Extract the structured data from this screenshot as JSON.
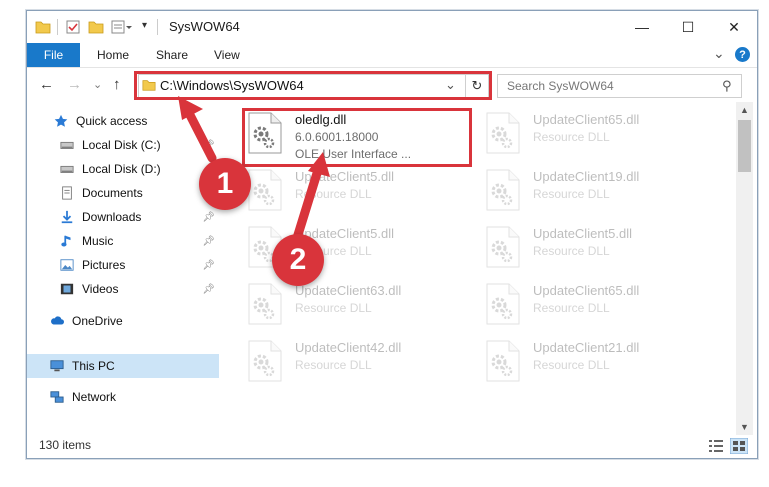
{
  "window": {
    "title": "SysWOW64",
    "minimize": "—",
    "maximize": "☐",
    "close": "✕"
  },
  "ribbon": {
    "tabs": [
      "File",
      "Home",
      "Share",
      "View"
    ],
    "expand": "⌄",
    "help": "?"
  },
  "address": {
    "path": "C:\\Windows\\SysWOW64",
    "dropdown": "⌄",
    "refresh": "↻",
    "search_placeholder": "Search SysWOW64",
    "search_icon": "⚲"
  },
  "nav": {
    "back": "←",
    "forward": "→",
    "recent": "⌄",
    "up": "↑",
    "items": [
      {
        "label": "Quick access",
        "icon": "star-icon"
      },
      {
        "label": "Local Disk (C:)",
        "icon": "drive-icon"
      },
      {
        "label": "Local Disk (D:)",
        "icon": "drive-icon"
      },
      {
        "label": "Documents",
        "icon": "documents-icon"
      },
      {
        "label": "Downloads",
        "icon": "downloads-icon"
      },
      {
        "label": "Music",
        "icon": "music-icon"
      },
      {
        "label": "Pictures",
        "icon": "pictures-icon"
      },
      {
        "label": "Videos",
        "icon": "videos-icon"
      },
      {
        "label": "OneDrive",
        "icon": "cloud-icon"
      },
      {
        "label": "This PC",
        "icon": "computer-icon"
      },
      {
        "label": "Network",
        "icon": "network-icon"
      }
    ]
  },
  "files": [
    {
      "name": "oledlg.dll",
      "line2": "6.0.6001.18000",
      "line3": "OLE User Interface ..."
    },
    {
      "name": "UpdateClient65.dll",
      "line2": "Resource DLL"
    },
    {
      "name": "UpdateClient5.dll",
      "line2": "Resource DLL"
    },
    {
      "name": "UpdateClient19.dll",
      "line2": "Resource DLL"
    },
    {
      "name": "UpdateClient5.dll",
      "line2": "Resource DLL"
    },
    {
      "name": "UpdateClient5.dll",
      "line2": "Resource DLL"
    },
    {
      "name": "UpdateClient63.dll",
      "line2": "Resource DLL"
    },
    {
      "name": "UpdateClient65.dll",
      "line2": "Resource DLL"
    },
    {
      "name": "UpdateClient42.dll",
      "line2": "Resource DLL"
    },
    {
      "name": "UpdateClient21.dll",
      "line2": "Resource DLL"
    }
  ],
  "status": {
    "count": "130 items"
  },
  "annotations": {
    "one": "1",
    "two": "2"
  },
  "colors": {
    "accent": "#1979ca",
    "highlight": "#d9343b",
    "selected": "#cce4f7"
  }
}
